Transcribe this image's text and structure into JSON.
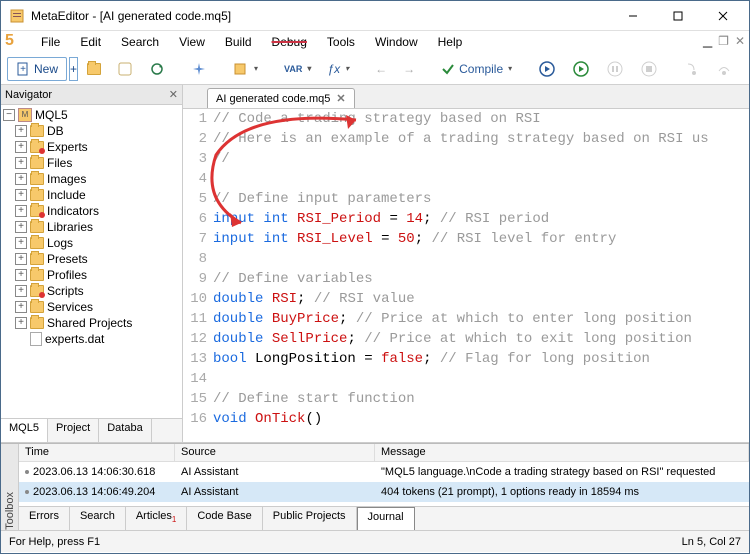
{
  "title": "MetaEditor - [AI generated code.mq5]",
  "menu": {
    "file": "File",
    "edit": "Edit",
    "search": "Search",
    "view": "View",
    "build": "Build",
    "debug": "Debug",
    "tools": "Tools",
    "window": "Window",
    "help": "Help"
  },
  "toolbar": {
    "new": "New",
    "compile": "Compile"
  },
  "navigator": {
    "title": "Navigator",
    "root": "MQL5",
    "items": [
      "DB",
      "Experts",
      "Files",
      "Images",
      "Include",
      "Indicators",
      "Libraries",
      "Logs",
      "Presets",
      "Profiles",
      "Scripts",
      "Services",
      "Shared Projects",
      "experts.dat"
    ],
    "tabs": {
      "mql5": "MQL5",
      "project": "Project",
      "databa": "Databa"
    }
  },
  "editor": {
    "tab": "AI generated code.mq5",
    "lines": [
      {
        "n": "1",
        "seg": [
          {
            "t": "// Code a trading strategy based on RSI",
            "c": "c-comment"
          }
        ]
      },
      {
        "n": "2",
        "seg": [
          {
            "t": "// Here is an example of a trading strategy based on RSI us",
            "c": "c-comment"
          }
        ]
      },
      {
        "n": "3",
        "seg": [
          {
            "t": "//",
            "c": "c-comment"
          }
        ]
      },
      {
        "n": "4",
        "seg": [
          {
            "t": "",
            "c": ""
          }
        ]
      },
      {
        "n": "5",
        "seg": [
          {
            "t": "// Define input parameters",
            "c": "c-comment"
          }
        ]
      },
      {
        "n": "6",
        "seg": [
          {
            "t": "input",
            "c": "c-kw"
          },
          {
            "t": " ",
            "c": ""
          },
          {
            "t": "int",
            "c": "c-type"
          },
          {
            "t": " ",
            "c": ""
          },
          {
            "t": "RSI_Period",
            "c": "c-ident"
          },
          {
            "t": " = ",
            "c": ""
          },
          {
            "t": "14",
            "c": "c-num"
          },
          {
            "t": "; ",
            "c": ""
          },
          {
            "t": "// RSI period",
            "c": "c-comment"
          }
        ]
      },
      {
        "n": "7",
        "seg": [
          {
            "t": "input",
            "c": "c-kw"
          },
          {
            "t": " ",
            "c": ""
          },
          {
            "t": "int",
            "c": "c-type"
          },
          {
            "t": " ",
            "c": ""
          },
          {
            "t": "RSI_Level",
            "c": "c-ident"
          },
          {
            "t": " = ",
            "c": ""
          },
          {
            "t": "50",
            "c": "c-num"
          },
          {
            "t": "; ",
            "c": ""
          },
          {
            "t": "// RSI level for entry",
            "c": "c-comment"
          }
        ]
      },
      {
        "n": "8",
        "seg": [
          {
            "t": "",
            "c": ""
          }
        ]
      },
      {
        "n": "9",
        "seg": [
          {
            "t": "// Define variables",
            "c": "c-comment"
          }
        ]
      },
      {
        "n": "10",
        "seg": [
          {
            "t": "double",
            "c": "c-type"
          },
          {
            "t": " ",
            "c": ""
          },
          {
            "t": "RSI",
            "c": "c-ident"
          },
          {
            "t": "; ",
            "c": ""
          },
          {
            "t": "// RSI value",
            "c": "c-comment"
          }
        ]
      },
      {
        "n": "11",
        "seg": [
          {
            "t": "double",
            "c": "c-type"
          },
          {
            "t": " ",
            "c": ""
          },
          {
            "t": "BuyPrice",
            "c": "c-ident"
          },
          {
            "t": "; ",
            "c": ""
          },
          {
            "t": "// Price at which to enter long position",
            "c": "c-comment"
          }
        ]
      },
      {
        "n": "12",
        "seg": [
          {
            "t": "double",
            "c": "c-type"
          },
          {
            "t": " ",
            "c": ""
          },
          {
            "t": "SellPrice",
            "c": "c-ident"
          },
          {
            "t": "; ",
            "c": ""
          },
          {
            "t": "// Price at which to exit long position",
            "c": "c-comment"
          }
        ]
      },
      {
        "n": "13",
        "seg": [
          {
            "t": "bool",
            "c": "c-type"
          },
          {
            "t": " ",
            "c": ""
          },
          {
            "t": "LongPosition",
            "c": ""
          },
          {
            "t": " = ",
            "c": ""
          },
          {
            "t": "false",
            "c": "c-bool"
          },
          {
            "t": "; ",
            "c": ""
          },
          {
            "t": "// Flag for long position",
            "c": "c-comment"
          }
        ]
      },
      {
        "n": "14",
        "seg": [
          {
            "t": "",
            "c": ""
          }
        ]
      },
      {
        "n": "15",
        "seg": [
          {
            "t": "// Define start function",
            "c": "c-comment"
          }
        ]
      },
      {
        "n": "16",
        "seg": [
          {
            "t": "void",
            "c": "c-type"
          },
          {
            "t": " ",
            "c": ""
          },
          {
            "t": "OnTick",
            "c": "c-ident"
          },
          {
            "t": "()",
            "c": ""
          }
        ]
      }
    ]
  },
  "log": {
    "side": "Toolbox",
    "headers": {
      "c1": "Time",
      "c2": "Source",
      "c3": "Message"
    },
    "rows": [
      {
        "c1": "2023.06.13 14:06:30.618",
        "c2": "AI Assistant",
        "c3": "\"MQL5 language.\\nCode a trading strategy based on RSI\" requested"
      },
      {
        "c1": "2023.06.13 14:06:49.204",
        "c2": "AI Assistant",
        "c3": "404 tokens (21 prompt), 1 options ready in 18594 ms"
      }
    ],
    "tabs": {
      "errors": "Errors",
      "search": "Search",
      "articles": "Articles",
      "codebase": "Code Base",
      "public": "Public Projects",
      "journal": "Journal"
    }
  },
  "status": {
    "left": "For Help, press F1",
    "right": "Ln 5, Col 27"
  }
}
